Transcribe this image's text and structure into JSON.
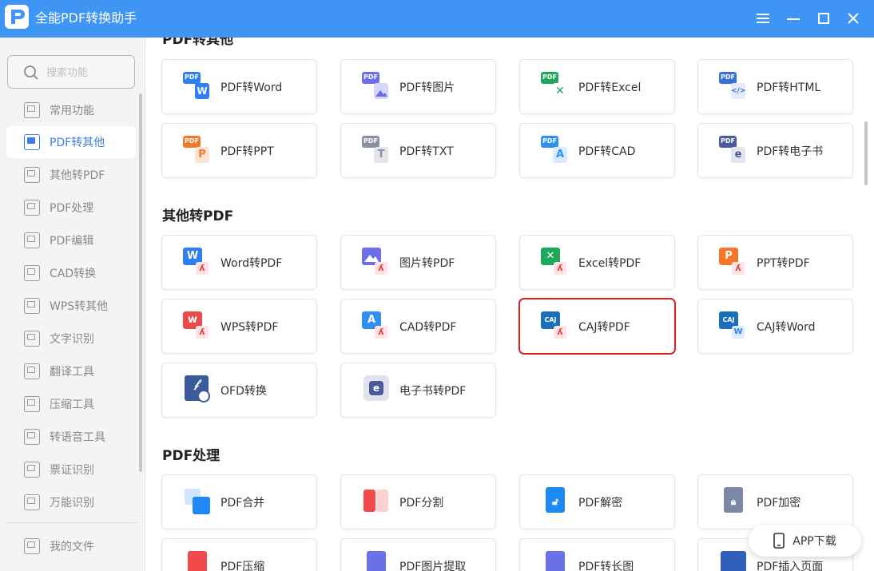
{
  "window": {
    "title": "全能PDF转换助手"
  },
  "search": {
    "placeholder": "搜索功能"
  },
  "sidebar": {
    "items": [
      {
        "label": "常用功能"
      },
      {
        "label": "PDF转其他"
      },
      {
        "label": "其他转PDF"
      },
      {
        "label": "PDF处理"
      },
      {
        "label": "PDF编辑"
      },
      {
        "label": "CAD转换"
      },
      {
        "label": "WPS转其他"
      },
      {
        "label": "文字识别"
      },
      {
        "label": "翻译工具"
      },
      {
        "label": "压缩工具"
      },
      {
        "label": "转语音工具"
      },
      {
        "label": "票证识别"
      },
      {
        "label": "万能识别"
      }
    ],
    "active": "PDF转其他",
    "my_files": "我的文件"
  },
  "sections": {
    "pdf_to_other": {
      "title": "PDF转其他",
      "cards": [
        "PDF转Word",
        "PDF转图片",
        "PDF转Excel",
        "PDF转HTML",
        "PDF转PPT",
        "PDF转TXT",
        "PDF转CAD",
        "PDF转电子书"
      ]
    },
    "other_to_pdf": {
      "title": "其他转PDF",
      "cards": [
        "Word转PDF",
        "图片转PDF",
        "Excel转PDF",
        "PPT转PDF",
        "WPS转PDF",
        "CAD转PDF",
        "CAJ转PDF",
        "CAJ转Word",
        "OFD转换",
        "电子书转PDF"
      ]
    },
    "pdf_processing": {
      "title": "PDF处理",
      "cards": [
        "PDF合并",
        "PDF分割",
        "PDF解密",
        "PDF加密",
        "PDF压缩",
        "PDF图片提取",
        "PDF转长图",
        "PDF插入页面"
      ]
    }
  },
  "icon_badges": {
    "pdf": "PDF",
    "caj": "CAJ"
  },
  "highlighted_card": "CAJ转PDF",
  "app_download": {
    "label": "APP下载"
  },
  "colors": {
    "titlebar": "#3f95f3",
    "accent": "#3f7fdc",
    "highlight": "#e02020"
  }
}
